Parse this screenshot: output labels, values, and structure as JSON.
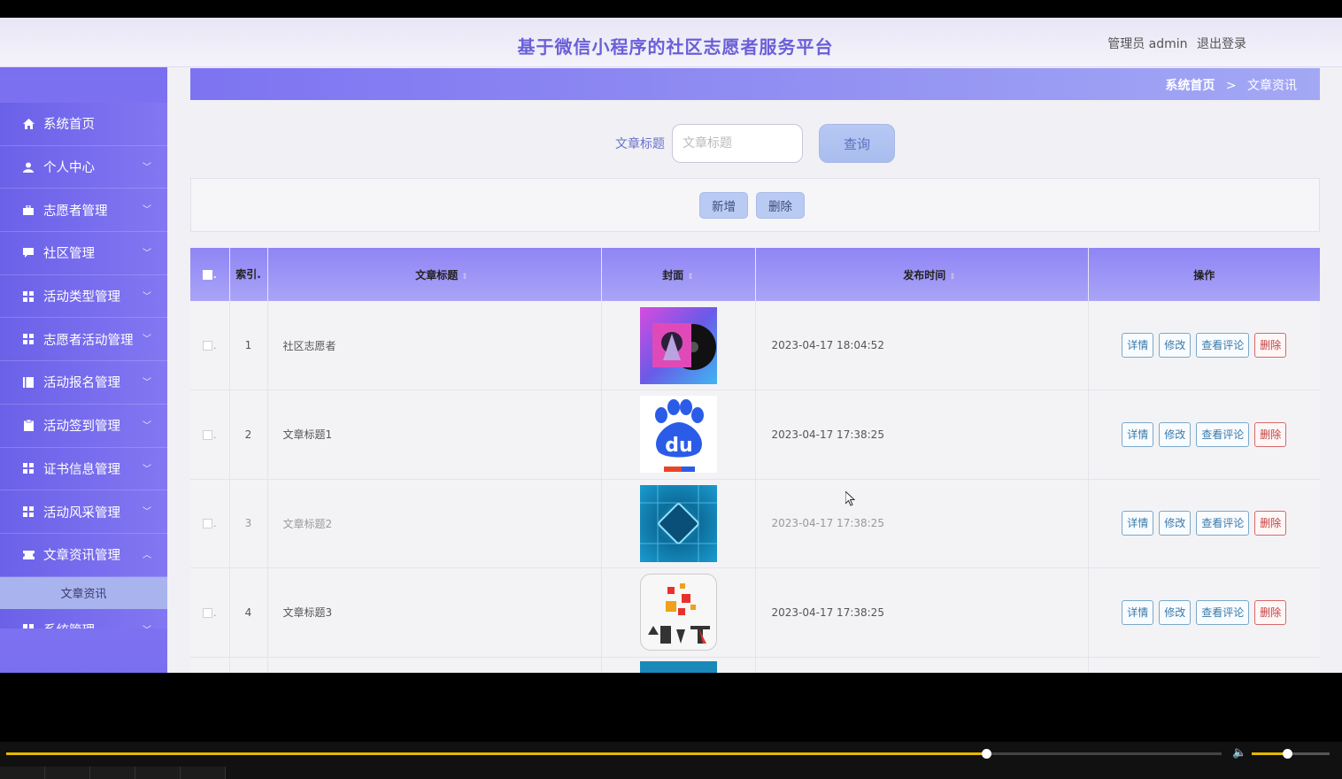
{
  "header": {
    "title": "基于微信小程序的社区志愿者服务平台",
    "user_role": "管理员 admin",
    "logout_label": "退出登录"
  },
  "sidebar": {
    "items": [
      {
        "label": "系统首页",
        "icon": "home-icon",
        "has_arrow": false
      },
      {
        "label": "个人中心",
        "icon": "user-icon",
        "has_arrow": true
      },
      {
        "label": "志愿者管理",
        "icon": "briefcase-icon",
        "has_arrow": true
      },
      {
        "label": "社区管理",
        "icon": "comment-icon",
        "has_arrow": true
      },
      {
        "label": "活动类型管理",
        "icon": "grid-icon",
        "has_arrow": true
      },
      {
        "label": "志愿者活动管理",
        "icon": "grid-icon",
        "has_arrow": true
      },
      {
        "label": "活动报名管理",
        "icon": "book-icon",
        "has_arrow": true
      },
      {
        "label": "活动签到管理",
        "icon": "clipboard-icon",
        "has_arrow": true
      },
      {
        "label": "证书信息管理",
        "icon": "grid-icon",
        "has_arrow": true
      },
      {
        "label": "活动风采管理",
        "icon": "grid-icon",
        "has_arrow": true
      },
      {
        "label": "文章资讯管理",
        "icon": "ticket-icon",
        "has_arrow": true,
        "expanded": true
      }
    ],
    "submenu_label": "文章资讯",
    "partial_item_label": "系统管理"
  },
  "breadcrumb": {
    "home": "系统首页",
    "separator": ">",
    "current": "文章资讯"
  },
  "search": {
    "label": "文章标题",
    "placeholder": "文章标题",
    "button_label": "查询"
  },
  "actions": {
    "add_label": "新增",
    "delete_label": "删除"
  },
  "table": {
    "headers": {
      "index": "索引.",
      "title": "文章标题",
      "cover": "封面",
      "time": "发布时间",
      "ops": "操作"
    },
    "op_labels": {
      "detail": "详情",
      "edit": "修改",
      "comments": "查看评论",
      "delete": "删除"
    },
    "rows": [
      {
        "index": "1",
        "title": "社区志愿者",
        "time": "2023-04-17 18:04:52",
        "cover": "music-cover-image"
      },
      {
        "index": "2",
        "title": "文章标题1",
        "time": "2023-04-17 17:38:25",
        "cover": "baidu-logo-image"
      },
      {
        "index": "3",
        "title": "文章标题2",
        "time": "2023-04-17 17:38:25",
        "cover": "chip-image"
      },
      {
        "index": "4",
        "title": "文章标题3",
        "time": "2023-04-17 17:38:25",
        "cover": "huashu-tv-logo-image"
      }
    ]
  },
  "player": {
    "progress": 0.806,
    "volume": 0.45
  },
  "colors": {
    "accent": "#7a6ff0",
    "title": "#6a5fd8",
    "danger": "#c24040",
    "progress": "#e6b900"
  }
}
